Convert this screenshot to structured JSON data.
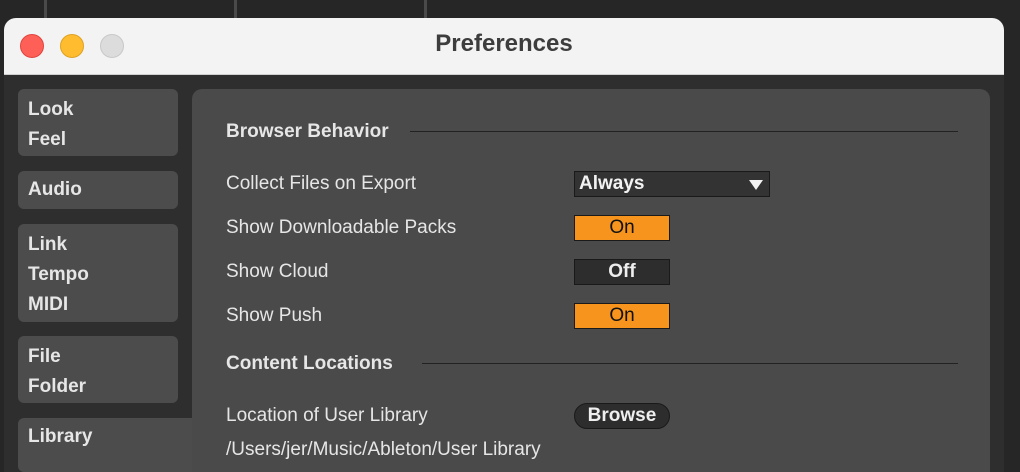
{
  "window": {
    "title": "Preferences"
  },
  "sidebar": {
    "groups": [
      {
        "lines": [
          "Look",
          "Feel"
        ]
      },
      {
        "lines": [
          "Audio"
        ]
      },
      {
        "lines": [
          "Link",
          "Tempo",
          "MIDI"
        ]
      },
      {
        "lines": [
          "File",
          "Folder"
        ]
      },
      {
        "lines": [
          "Library"
        ],
        "selected": true
      }
    ]
  },
  "browser_behavior": {
    "header": "Browser Behavior",
    "collect_files": {
      "label": "Collect Files on Export",
      "value": "Always"
    },
    "show_downloadable_packs": {
      "label": "Show Downloadable Packs",
      "value": "On"
    },
    "show_cloud": {
      "label": "Show Cloud",
      "value": "Off"
    },
    "show_push": {
      "label": "Show Push",
      "value": "On"
    }
  },
  "content_locations": {
    "header": "Content Locations",
    "user_library": {
      "label": "Location of User Library",
      "button": "Browse",
      "path": "/Users/jer/Music/Ableton/User Library"
    }
  },
  "colors": {
    "toggle_on": "#f7941e",
    "panel": "#4a4a4a",
    "background": "#2e2e2e"
  }
}
